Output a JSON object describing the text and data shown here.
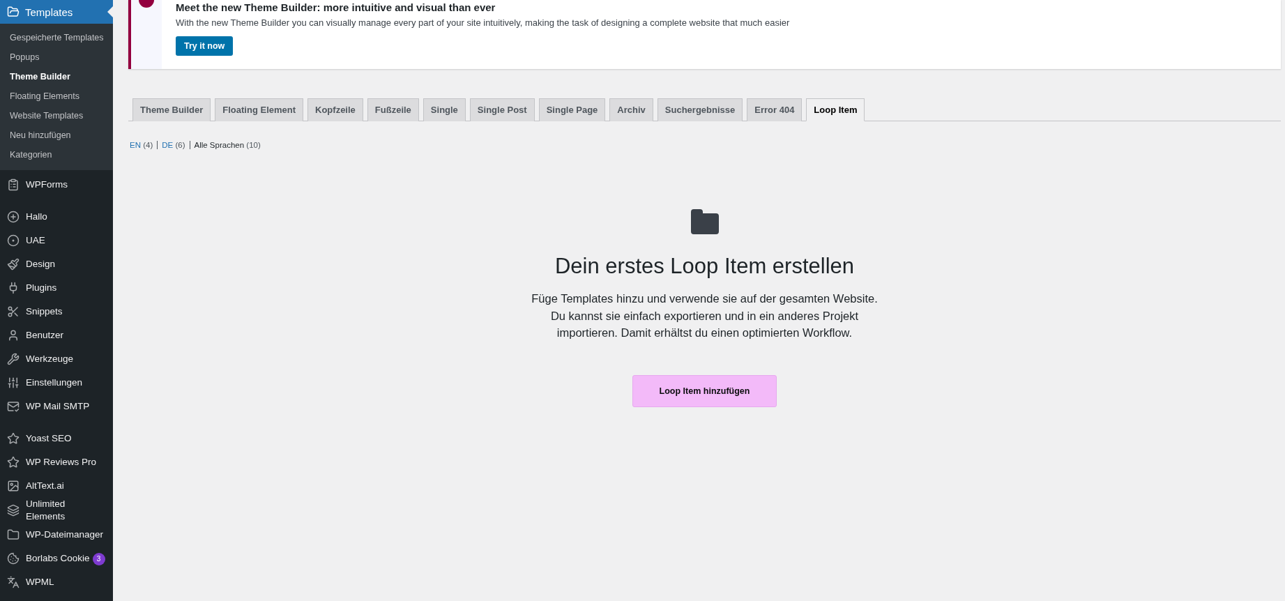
{
  "sidebar": {
    "current": {
      "label": "Templates"
    },
    "submenu": [
      {
        "label": "Gespeicherte Templates",
        "selected": false
      },
      {
        "label": "Popups",
        "selected": false
      },
      {
        "label": "Theme Builder",
        "selected": true
      },
      {
        "label": "Floating Elements",
        "selected": false
      },
      {
        "label": "Website Templates",
        "selected": false
      },
      {
        "label": "Neu hinzufügen",
        "selected": false
      },
      {
        "label": "Kategorien",
        "selected": false
      }
    ],
    "menu_groups": [
      [
        {
          "label": "WPForms"
        }
      ],
      [
        {
          "label": "Hallo"
        },
        {
          "label": "UAE"
        },
        {
          "label": "Design"
        },
        {
          "label": "Plugins"
        },
        {
          "label": "Snippets"
        },
        {
          "label": "Benutzer"
        },
        {
          "label": "Werkzeuge"
        },
        {
          "label": "Einstellungen"
        },
        {
          "label": "WP Mail SMTP"
        }
      ],
      [
        {
          "label": "Yoast SEO"
        },
        {
          "label": "WP Reviews Pro"
        },
        {
          "label": "AltText.ai"
        },
        {
          "label": "Unlimited Elements"
        },
        {
          "label": "WP-Dateimanager"
        },
        {
          "label": "Borlabs Cookie",
          "badge": "3"
        },
        {
          "label": "WPML"
        }
      ]
    ]
  },
  "notice": {
    "title": "Meet the new Theme Builder: more intuitive and visual than ever",
    "text": "With the new Theme Builder you can visually manage every part of your site intuitively, making the task of designing a complete website that much easier",
    "button": "Try it now"
  },
  "tabs": [
    {
      "label": "Theme Builder",
      "selected": false
    },
    {
      "label": "Floating Element",
      "selected": false
    },
    {
      "label": "Kopfzeile",
      "selected": false
    },
    {
      "label": "Fußzeile",
      "selected": false
    },
    {
      "label": "Single",
      "selected": false
    },
    {
      "label": "Single Post",
      "selected": false
    },
    {
      "label": "Single Page",
      "selected": false
    },
    {
      "label": "Archiv",
      "selected": false
    },
    {
      "label": "Suchergebnisse",
      "selected": false
    },
    {
      "label": "Error 404",
      "selected": false
    },
    {
      "label": "Loop Item",
      "selected": true
    }
  ],
  "languages": [
    {
      "label": "EN",
      "count": "(4)",
      "selected": false
    },
    {
      "label": "DE",
      "count": "(6)",
      "selected": false
    },
    {
      "label": "Alle Sprachen",
      "count": "(10)",
      "selected": true
    }
  ],
  "empty_state": {
    "title": "Dein erstes Loop Item erstellen",
    "text": "Füge Templates hinzu und verwende sie auf der gesamten Website. Du kannst sie einfach exportieren und in ein anderes Projekt importieren. Damit erhältst du einen optimierten Workflow.",
    "button": "Loop Item hinzufügen"
  }
}
